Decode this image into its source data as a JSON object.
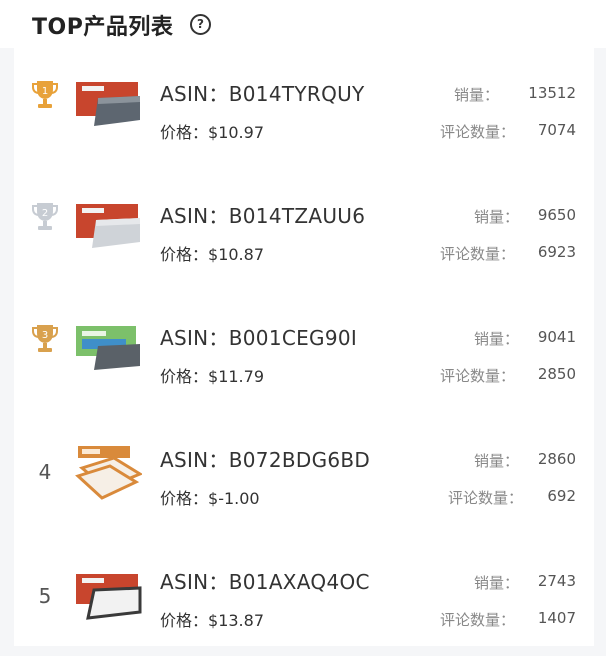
{
  "header": {
    "title": "TOP产品列表",
    "help_icon": "question-circle-icon",
    "help_symbol": "?"
  },
  "labels": {
    "asin_prefix": "ASIN：",
    "price_prefix": "价格：",
    "sales": "销量：",
    "reviews": "评论数量："
  },
  "products": [
    {
      "rank": "1",
      "rank_icon": "gold-trophy-icon",
      "asin": "B014TYRQUY",
      "price": "$10.97",
      "sales": "13512",
      "reviews": "7074"
    },
    {
      "rank": "2",
      "rank_icon": "silver-trophy-icon",
      "asin": "B014TZAUU6",
      "price": "$10.87",
      "sales": "9650",
      "reviews": "6923"
    },
    {
      "rank": "3",
      "rank_icon": "bronze-trophy-icon",
      "asin": "B001CEG90I",
      "price": "$11.79",
      "sales": "9041",
      "reviews": "2850"
    },
    {
      "rank": "4",
      "rank_icon": "",
      "asin": "B072BDG6BD",
      "price": "$-1.00",
      "sales": "2860",
      "reviews": "692"
    },
    {
      "rank": "5",
      "rank_icon": "",
      "asin": "B01AXAQ4OC",
      "price": "$13.87",
      "sales": "2743",
      "reviews": "1407"
    }
  ],
  "colors": {
    "gold": "#e8a23a",
    "silver": "#c7ccd3",
    "bronze": "#d9a14e"
  }
}
